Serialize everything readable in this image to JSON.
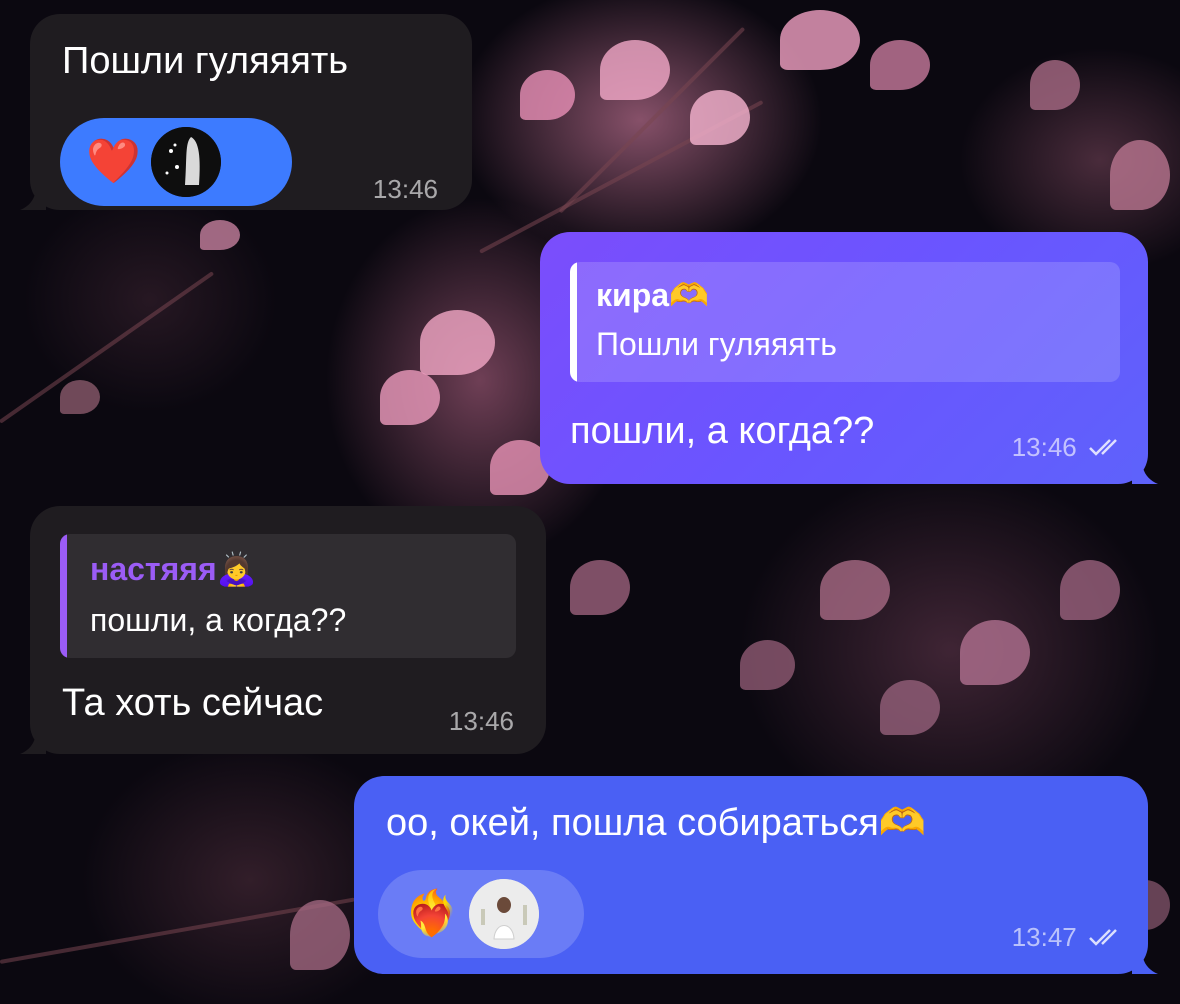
{
  "messages": [
    {
      "text": "Пошли гуляяять",
      "time": "13:46",
      "reaction": {
        "emoji": "heart-icon",
        "glyph": "❤️"
      }
    },
    {
      "reply": {
        "name": "кира🫶",
        "text": "Пошли гуляяять"
      },
      "text": "пошли, а когда??",
      "time": "13:46",
      "status": "read"
    },
    {
      "reply": {
        "name": "настяяя🙇‍♀️",
        "text": "пошли, а когда??"
      },
      "text": "Та хоть сейчас",
      "time": "13:46"
    },
    {
      "text": "оо, окей, пошла собираться🫶",
      "time": "13:47",
      "status": "read",
      "reaction": {
        "emoji": "heart-on-fire-icon",
        "glyph": "❤️‍🔥"
      }
    }
  ],
  "colors": {
    "incoming_bubble": "#1f1c20",
    "outgoing_bubble_gradient": [
      "#7b4dfc",
      "#5e62fb"
    ],
    "outgoing_bubble_solid": "#4a60f4",
    "reaction_blue": "#3d7bff",
    "reply_accent_purple": "#9b5cf6"
  }
}
